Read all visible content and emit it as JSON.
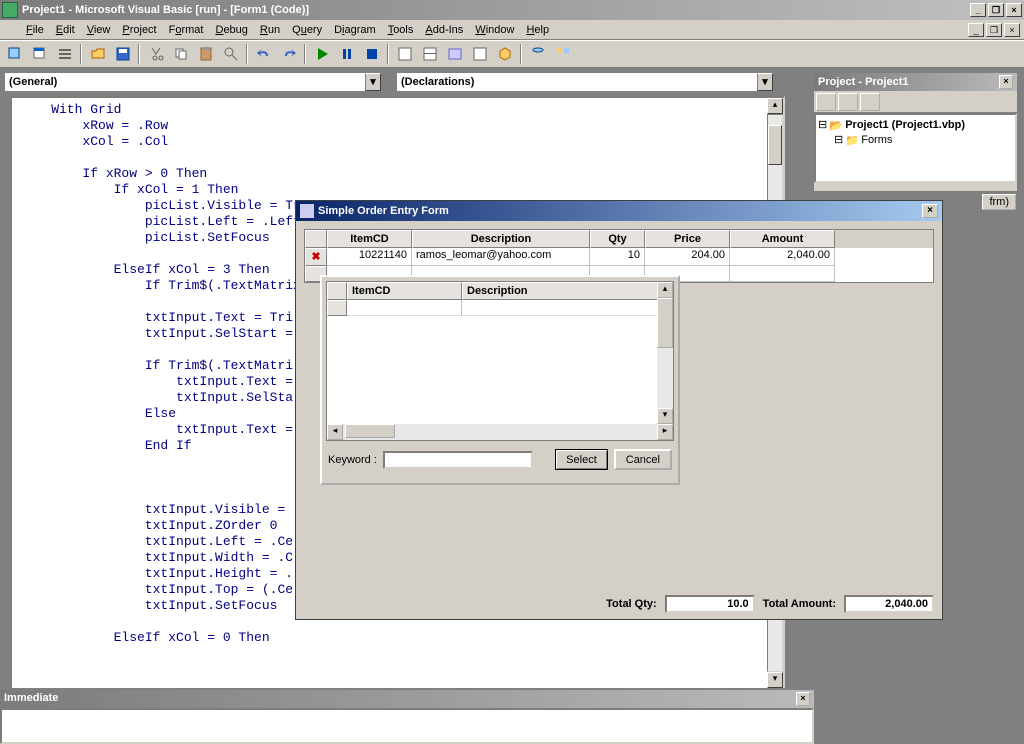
{
  "app": {
    "title": "Project1 - Microsoft Visual Basic [run] - [Form1 (Code)]"
  },
  "menu": [
    "File",
    "Edit",
    "View",
    "Project",
    "Format",
    "Debug",
    "Run",
    "Query",
    "Diagram",
    "Tools",
    "Add-Ins",
    "Window",
    "Help"
  ],
  "combos": {
    "left": "(General)",
    "right": "(Declarations)"
  },
  "code": "    With Grid\n        xRow = .Row\n        xCol = .Col\n\n        If xRow > 0 Then\n            If xCol = 1 Then\n                picList.Visible = Tru\n                picList.Left = .Left\n                picList.SetFocus\n\n            ElseIf xCol = 3 Then\n                If Trim$(.TextMatrix\n\n                txtInput.Text = Tri\n                txtInput.SelStart =\n\n                If Trim$(.TextMatri\n                    txtInput.Text =\n                    txtInput.SelSta\n                Else\n                    txtInput.Text =\n                End If\n\n\n\n                txtInput.Visible =\n                txtInput.ZOrder 0\n                txtInput.Left = .Ce\n                txtInput.Width = .C\n                txtInput.Height = .\n                txtInput.Top = (.Ce\n                txtInput.SetFocus\n\n            ElseIf xCol = 0 Then",
  "immediate": {
    "title": "Immediate"
  },
  "project": {
    "title": "Project - Project1",
    "root": "Project1 (Project1.vbp)",
    "folder": "Forms",
    "frm_tab": "frm)"
  },
  "orderForm": {
    "title": "Simple Order Entry Form",
    "grid": {
      "headers": [
        "",
        "ItemCD",
        "Description",
        "Qty",
        "Price",
        "Amount"
      ],
      "row": {
        "itemcd": "10221140",
        "desc": "ramos_leomar@yahoo.com",
        "qty": "10",
        "price": "204.00",
        "amount": "2,040.00"
      }
    },
    "lookup": {
      "headers": [
        "",
        "ItemCD",
        "Description"
      ],
      "keyword_label": "Keyword :",
      "select_btn": "Select",
      "cancel_btn": "Cancel"
    },
    "totals": {
      "qty_label": "Total Qty:",
      "qty_value": "10.0",
      "amount_label": "Total Amount:",
      "amount_value": "2,040.00"
    }
  }
}
